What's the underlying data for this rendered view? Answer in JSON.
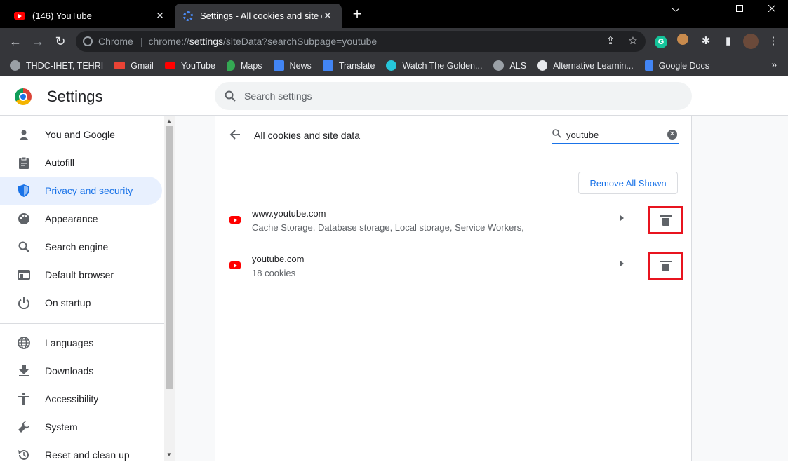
{
  "tabs": [
    {
      "title": "(146) YouTube"
    },
    {
      "title": "Settings - All cookies and site data"
    }
  ],
  "window_controls": {
    "minimize": "—",
    "maximize": "☐",
    "close": "✕"
  },
  "omnibox": {
    "chip_label": "Chrome",
    "separator": "|",
    "url_scheme": "chrome://",
    "url_host": "settings",
    "url_path": "/siteData?searchSubpage=youtube"
  },
  "bookmarks": [
    {
      "label": "THDC-IHET, TEHRI",
      "icon": "globe-icon",
      "color": "#9aa0a6"
    },
    {
      "label": "Gmail",
      "icon": "gmail-icon",
      "color": "#ea4335"
    },
    {
      "label": "YouTube",
      "icon": "youtube-icon",
      "color": "#ff0000"
    },
    {
      "label": "Maps",
      "icon": "maps-icon",
      "color": "#34a853"
    },
    {
      "label": "News",
      "icon": "news-icon",
      "color": "#4285f4"
    },
    {
      "label": "Translate",
      "icon": "translate-icon",
      "color": "#4285f4"
    },
    {
      "label": "Watch The Golden...",
      "icon": "play-icon",
      "color": "#26c6da"
    },
    {
      "label": "ALS",
      "icon": "globe-icon",
      "color": "#9aa0a6"
    },
    {
      "label": "Alternative Learnin...",
      "icon": "sound-icon",
      "color": "#e8eaed"
    },
    {
      "label": "Google Docs",
      "icon": "docs-icon",
      "color": "#4285f4"
    }
  ],
  "bookmarks_more": "»",
  "header": {
    "title": "Settings",
    "search_placeholder": "Search settings"
  },
  "sidebar": {
    "items": [
      {
        "label": "You and Google",
        "icon": "person-icon",
        "active": false
      },
      {
        "label": "Autofill",
        "icon": "clipboard-icon",
        "active": false
      },
      {
        "label": "Privacy and security",
        "icon": "shield-icon",
        "active": true
      },
      {
        "label": "Appearance",
        "icon": "palette-icon",
        "active": false
      },
      {
        "label": "Search engine",
        "icon": "search-icon",
        "active": false
      },
      {
        "label": "Default browser",
        "icon": "browser-icon",
        "active": false
      },
      {
        "label": "On startup",
        "icon": "power-icon",
        "active": false
      },
      {
        "label": "Languages",
        "icon": "globe-icon",
        "active": false
      },
      {
        "label": "Downloads",
        "icon": "download-icon",
        "active": false
      },
      {
        "label": "Accessibility",
        "icon": "accessibility-icon",
        "active": false
      },
      {
        "label": "System",
        "icon": "wrench-icon",
        "active": false
      },
      {
        "label": "Reset and clean up",
        "icon": "reset-icon",
        "active": false
      }
    ]
  },
  "subpage": {
    "title": "All cookies and site data",
    "search_value": "youtube",
    "remove_all_label": "Remove All Shown",
    "sites": [
      {
        "name": "www.youtube.com",
        "description": "Cache Storage, Database storage, Local storage, Service Workers,"
      },
      {
        "name": "youtube.com",
        "description": "18 cookies"
      }
    ]
  },
  "colors": {
    "accent": "#1a73e8",
    "highlight_box": "#e8141f",
    "youtube_red": "#ff0000"
  }
}
